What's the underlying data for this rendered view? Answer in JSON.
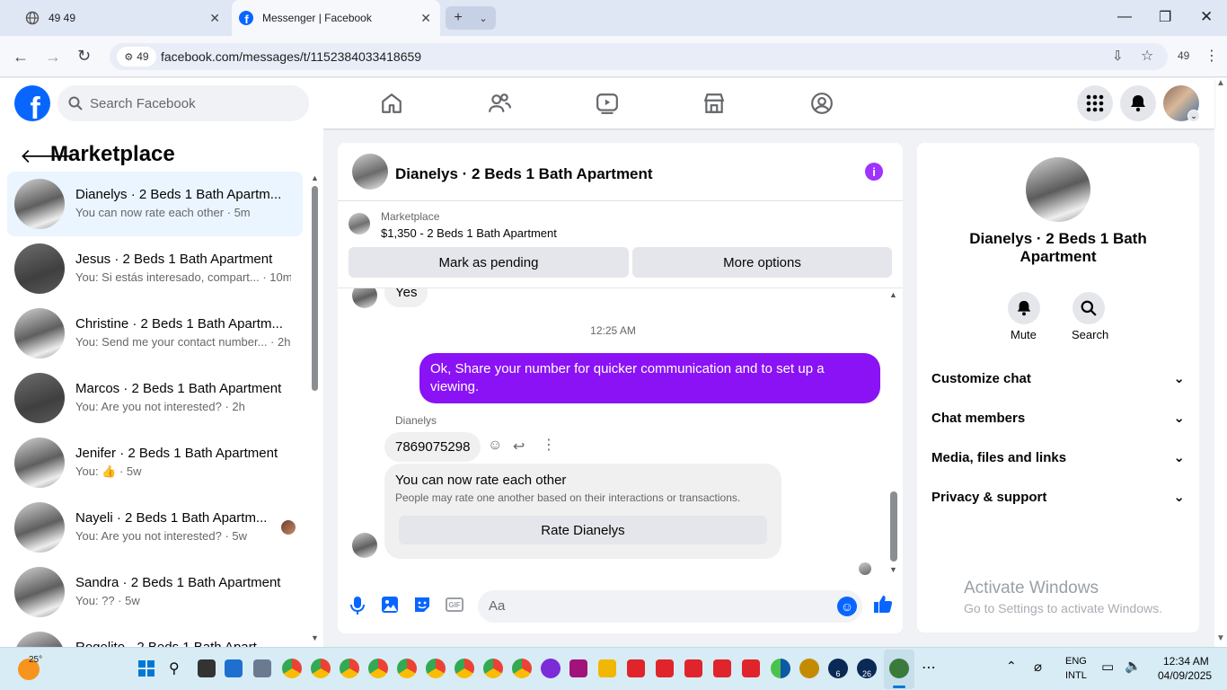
{
  "browser": {
    "tabs": [
      {
        "title": "49 49",
        "active": false
      },
      {
        "title": "Messenger | Facebook",
        "active": true
      }
    ],
    "site_badge": "49",
    "url": "facebook.com/messages/t/1152384033418659",
    "profile_count": "49"
  },
  "fb": {
    "search_placeholder": "Search Facebook"
  },
  "sidebar": {
    "title": "Marketplace",
    "conversations": [
      {
        "name": "Dianelys · 2 Beds 1 Bath Apartm...",
        "preview": "You can now rate each other · 5m",
        "active": true
      },
      {
        "name": "Jesus · 2 Beds 1 Bath Apartment",
        "preview": "You: Si estás interesado, compart... · 10m",
        "active": false
      },
      {
        "name": "Christine · 2 Beds 1 Bath Apartm...",
        "preview": "You: Send me your contact number... · 2h",
        "active": false
      },
      {
        "name": "Marcos · 2 Beds 1 Bath Apartment",
        "preview": "You: Are you not interested? · 2h",
        "active": false
      },
      {
        "name": "Jenifer · 2 Beds 1 Bath Apartment",
        "preview": "You: 👍 · 5w",
        "active": false
      },
      {
        "name": "Nayeli · 2 Beds 1 Bath Apartm...",
        "preview": "You: Are you not interested? · 5w",
        "active": false
      },
      {
        "name": "Sandra · 2 Beds 1 Bath Apartment",
        "preview": "You: ?? · 5w",
        "active": false
      },
      {
        "name": "Rogelito · 2 Beds 1 Bath Apart...",
        "preview": "",
        "active": false
      }
    ]
  },
  "chat": {
    "title": "Dianelys · 2 Beds 1 Bath Apartment",
    "banner": {
      "label": "Marketplace",
      "listing": "$1,350 - 2 Beds 1 Bath Apartment",
      "pending_button": "Mark as pending",
      "options_button": "More options"
    },
    "messages": {
      "prev_reply": "Yes",
      "timestamp": "12:25 AM",
      "outgoing": "Ok, Share your number for quicker communication and to set up a viewing.",
      "sender": "Dianelys",
      "incoming_phone": "7869075298",
      "rate_card_title": "You can now rate each other",
      "rate_card_body": "People may rate one another based on their interactions or transactions.",
      "rate_button": "Rate Dianelys"
    },
    "composer_placeholder": "Aa"
  },
  "info_panel": {
    "title": "Dianelys · 2 Beds 1 Bath Apartment",
    "mute_label": "Mute",
    "search_label": "Search",
    "sections": [
      "Customize chat",
      "Chat members",
      "Media, files and links",
      "Privacy & support"
    ]
  },
  "watermark": {
    "line1": "Activate Windows",
    "line2": "Go to Settings to activate Windows."
  },
  "taskbar": {
    "weather": "25°",
    "lang1": "ENG",
    "lang2": "INTL",
    "time": "12:34 AM",
    "date": "04/09/2025",
    "badge_six": "6",
    "badge_twentysix": "26"
  },
  "colors": {
    "fb_blue": "#0866ff",
    "outgoing_bubble": "#8a12f5",
    "info_purple": "#a033ff",
    "active_conv": "#ebf5ff"
  }
}
